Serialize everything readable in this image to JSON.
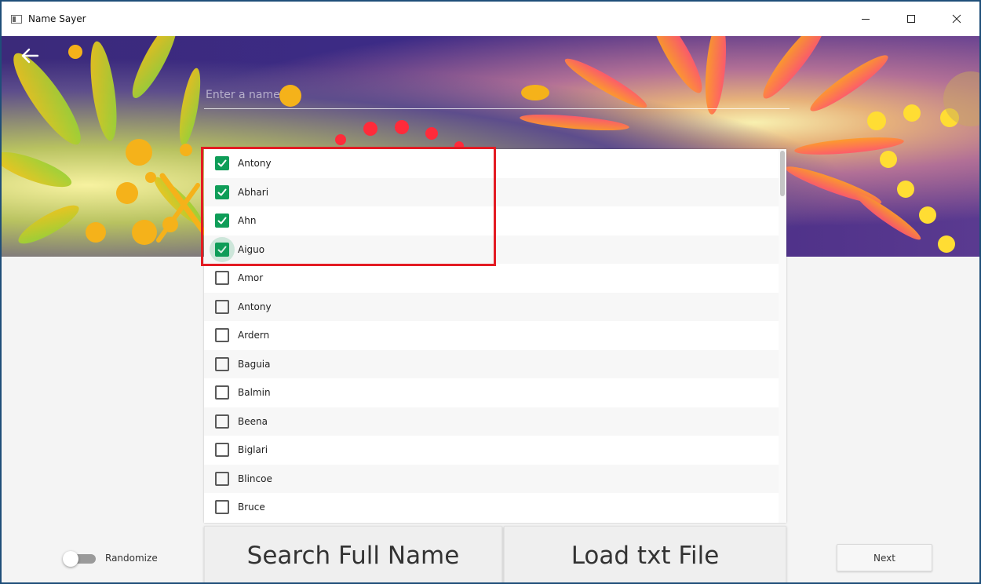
{
  "window": {
    "title": "Name Sayer"
  },
  "search": {
    "placeholder": "Enter a name",
    "value": ""
  },
  "names": [
    {
      "label": "Antony",
      "checked": true
    },
    {
      "label": "Abhari",
      "checked": true
    },
    {
      "label": "Ahn",
      "checked": true
    },
    {
      "label": "Aiguo",
      "checked": true,
      "focused": true
    },
    {
      "label": "Amor",
      "checked": false
    },
    {
      "label": "Antony",
      "checked": false
    },
    {
      "label": "Ardern",
      "checked": false
    },
    {
      "label": "Baguia",
      "checked": false
    },
    {
      "label": "Balmin",
      "checked": false
    },
    {
      "label": "Beena",
      "checked": false
    },
    {
      "label": "Biglari",
      "checked": false
    },
    {
      "label": "Blincoe",
      "checked": false
    },
    {
      "label": "Bruce",
      "checked": false
    }
  ],
  "actions": {
    "search_full_name": "Search Full Name",
    "load_txt_file": "Load txt File",
    "next": "Next"
  },
  "randomize": {
    "label": "Randomize",
    "on": false
  },
  "colors": {
    "accent": "#0f9d58",
    "highlight": "#e31b23",
    "window_border": "#1f4e79"
  },
  "icons": {
    "back": "arrow-left-icon",
    "minimize": "minimize-icon",
    "maximize": "maximize-icon",
    "close": "close-icon",
    "check": "check-icon"
  }
}
